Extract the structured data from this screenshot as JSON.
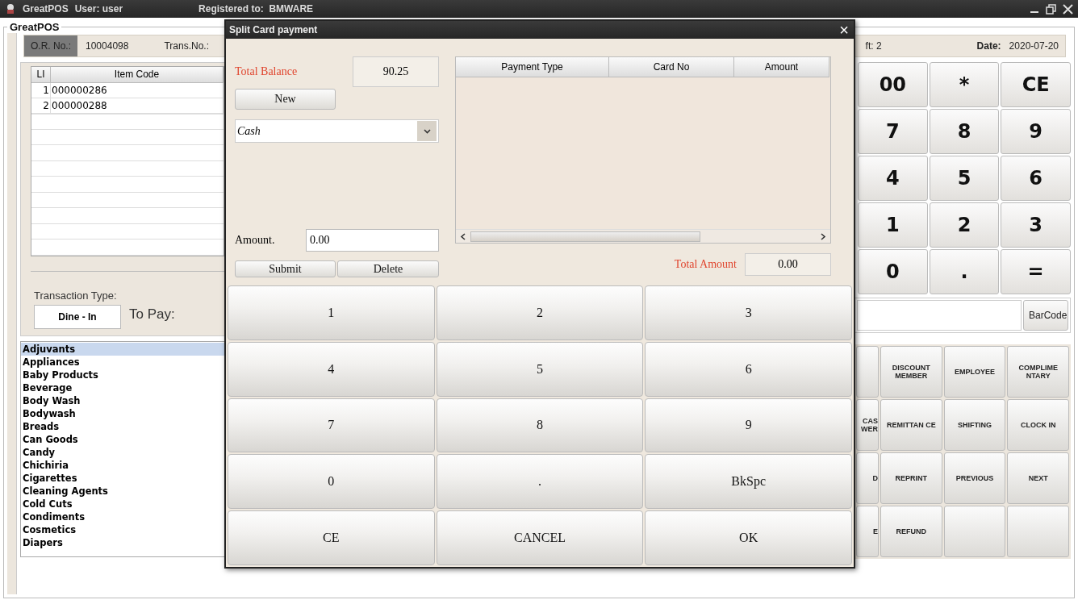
{
  "window": {
    "app_name": "GreatPOS",
    "user": "User: user",
    "registration": "Registered to:  BMWARE"
  },
  "main": {
    "group_title": "GreatPOS",
    "header": {
      "or_label": "O.R. No.:",
      "or_value": "10004098",
      "trans_label": "Trans.No.:",
      "shift_partial": "ft: 2",
      "date_label": "Date:",
      "date_value": "2020-07-20"
    },
    "items_table": {
      "columns": [
        "LI",
        "Item Code"
      ],
      "rows": [
        [
          "1",
          "000000286"
        ],
        [
          "2",
          "000000288"
        ]
      ]
    },
    "transaction": {
      "type_label": "Transaction Type:",
      "type_value": "Dine - In",
      "to_pay_label": "To Pay:"
    },
    "categories": [
      {
        "label": "Adjuvants",
        "selected": true
      },
      {
        "label": "Appliances",
        "selected": false
      },
      {
        "label": "Baby Products",
        "selected": false
      },
      {
        "label": "Beverage",
        "selected": false
      },
      {
        "label": "Body Wash",
        "selected": false
      },
      {
        "label": "Bodywash",
        "selected": false
      },
      {
        "label": "Breads",
        "selected": false
      },
      {
        "label": "Can Goods",
        "selected": false
      },
      {
        "label": "Candy",
        "selected": false
      },
      {
        "label": "Chichiria",
        "selected": false
      },
      {
        "label": "Cigarettes",
        "selected": false
      },
      {
        "label": "Cleaning Agents",
        "selected": false
      },
      {
        "label": "Cold Cuts",
        "selected": false
      },
      {
        "label": "Condiments",
        "selected": false
      },
      {
        "label": "Cosmetics",
        "selected": false
      },
      {
        "label": "Diapers",
        "selected": false
      }
    ],
    "keypad": [
      "00",
      "*",
      "CE",
      "7",
      "8",
      "9",
      "4",
      "5",
      "6",
      "1",
      "2",
      "3",
      "0",
      ".",
      "="
    ],
    "barcode_button": "BarCode",
    "function_buttons": [
      {
        "kind": "blank"
      },
      {
        "kind": "labeled",
        "label": "DISCOUNT MEMBER"
      },
      {
        "kind": "labeled",
        "label": "EMPLOYEE"
      },
      {
        "kind": "labeled",
        "label": "COMPLIME NTARY"
      },
      {
        "kind": "labeled",
        "label": "CAS WER"
      },
      {
        "kind": "labeled",
        "label": "REMITTAN CE"
      },
      {
        "kind": "labeled",
        "label": "SHIFTING"
      },
      {
        "kind": "labeled",
        "label": "CLOCK IN"
      },
      {
        "kind": "labeled",
        "label": "D"
      },
      {
        "kind": "labeled",
        "label": "REPRINT"
      },
      {
        "kind": "labeled",
        "label": "PREVIOUS"
      },
      {
        "kind": "labeled",
        "label": "NEXT"
      },
      {
        "kind": "labeled",
        "label": "E"
      },
      {
        "kind": "labeled",
        "label": "REFUND"
      },
      {
        "kind": "blank"
      },
      {
        "kind": "blank"
      }
    ]
  },
  "dialog": {
    "title": "Split Card payment",
    "close": "×",
    "total_balance_label": "Total Balance",
    "total_balance": "90.25",
    "new_button": "New",
    "payment_type": "Cash",
    "amount_label": "Amount.",
    "amount": "0.00",
    "submit_button": "Submit",
    "delete_button": "Delete",
    "payments_table": {
      "columns": [
        "Payment Type",
        "Card No",
        "Amount"
      ]
    },
    "total_amount_label": "Total Amount",
    "total_amount": "0.00",
    "keypad": [
      "1",
      "2",
      "3",
      "4",
      "5",
      "6",
      "7",
      "8",
      "9",
      "0",
      ".",
      "BkSpc",
      "CE",
      "CANCEL",
      "OK"
    ]
  }
}
